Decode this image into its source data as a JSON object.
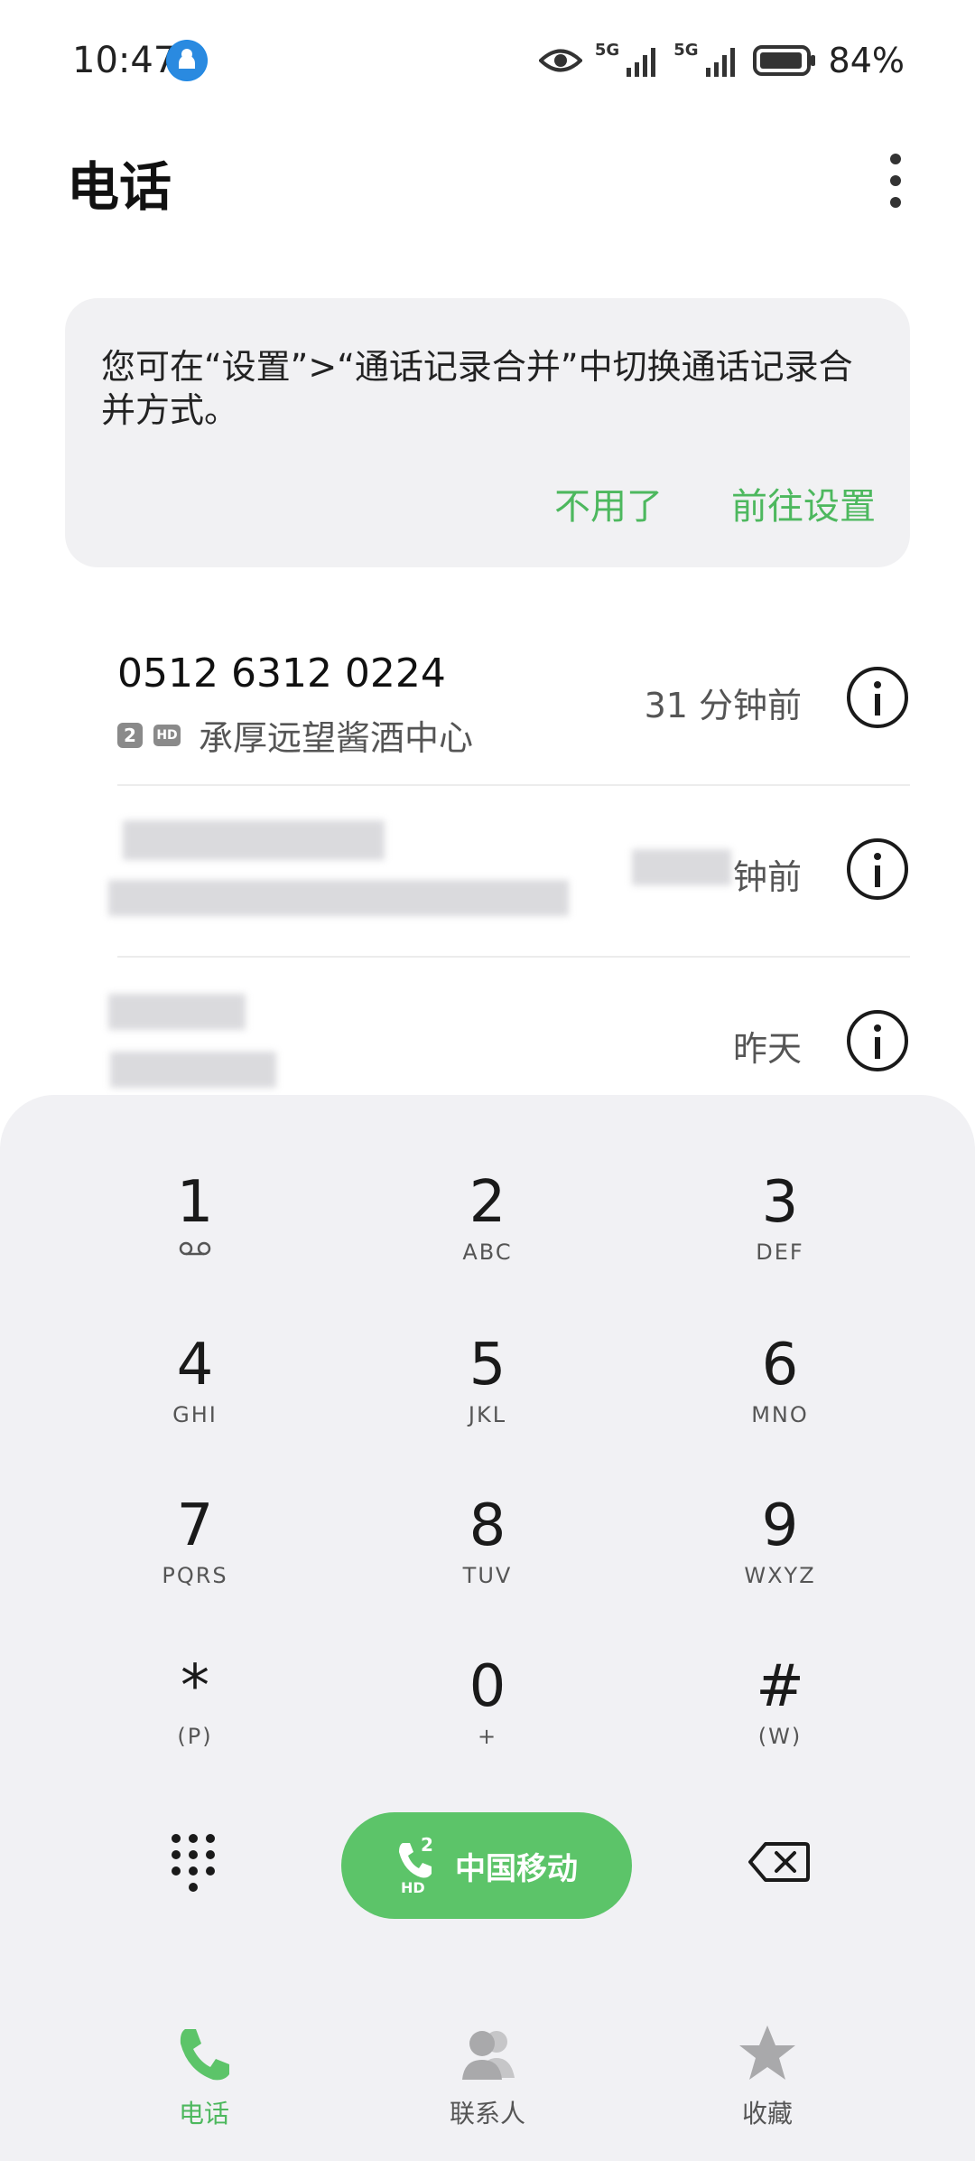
{
  "status_bar": {
    "time": "10:47",
    "network_1": "5G",
    "network_2": "5G",
    "battery": "84%"
  },
  "header": {
    "title": "电话"
  },
  "tip_card": {
    "text": "您可在“设置”>“通话记录合并”中切换通话记录合并方式。",
    "dismiss_label": "不用了",
    "settings_label": "前往设置"
  },
  "call_log": [
    {
      "number": "0512 6312 0224",
      "sim": "2",
      "location": "承厚远望酱酒中心",
      "time": "31 分钟前"
    },
    {
      "number": "",
      "sim": "",
      "location": "",
      "time": "钟前"
    },
    {
      "number": "",
      "sim": "",
      "location": "",
      "time": "昨天"
    }
  ],
  "dialpad": {
    "keys": [
      {
        "digit": "1",
        "letters": ""
      },
      {
        "digit": "2",
        "letters": "ABC"
      },
      {
        "digit": "3",
        "letters": "DEF"
      },
      {
        "digit": "4",
        "letters": "GHI"
      },
      {
        "digit": "5",
        "letters": "JKL"
      },
      {
        "digit": "6",
        "letters": "MNO"
      },
      {
        "digit": "7",
        "letters": "PQRS"
      },
      {
        "digit": "8",
        "letters": "TUV"
      },
      {
        "digit": "9",
        "letters": "WXYZ"
      },
      {
        "digit": "*",
        "letters": "(P)"
      },
      {
        "digit": "0",
        "letters": "+"
      },
      {
        "digit": "#",
        "letters": "(W)"
      }
    ],
    "call_button": {
      "carrier": "中国移动",
      "sim": "2",
      "hd": "HD"
    }
  },
  "bottom_nav": {
    "items": [
      {
        "label": "电话",
        "icon": "phone-icon",
        "active": true
      },
      {
        "label": "联系人",
        "icon": "contacts-icon",
        "active": false
      },
      {
        "label": "收藏",
        "icon": "star-icon",
        "active": false
      }
    ]
  },
  "colors": {
    "accent": "#4db85e",
    "call_button": "#5cc469",
    "panel_bg": "#f1f1f4"
  }
}
